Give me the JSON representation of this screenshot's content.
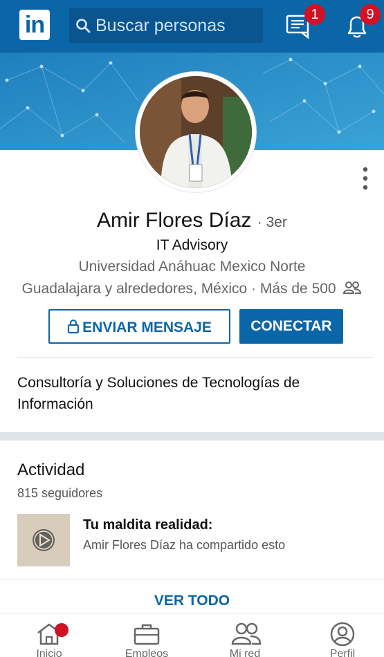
{
  "app": {
    "logo_text": "in"
  },
  "search": {
    "placeholder": "Buscar personas"
  },
  "header": {
    "messages_badge": "1",
    "notifications_badge": "9"
  },
  "profile": {
    "name": "Amir Flores Díaz",
    "degree": "· 3er",
    "headline": "IT Advisory",
    "school": "Universidad Anáhuac Mexico Norte",
    "location_connections": "Guadalajara y alrededores, México · Más de 500"
  },
  "actions": {
    "message_label": "ENVIAR MENSAJE",
    "connect_label": "CONECTAR"
  },
  "summary": {
    "text": "Consultoría y Soluciones de Tecnologías de Información"
  },
  "activity": {
    "title": "Actividad",
    "followers": "815 seguidores",
    "post_title": "Tu maldita realidad:",
    "post_subtitle": "Amir Flores Díaz ha compartido esto",
    "see_all": "VER TODO"
  },
  "bottom_nav": {
    "items": [
      {
        "label": "Inicio",
        "icon": "home-icon"
      },
      {
        "label": "Empleos",
        "icon": "briefcase-icon"
      },
      {
        "label": "Mi red",
        "icon": "network-icon"
      },
      {
        "label": "Perfil",
        "icon": "profile-icon"
      }
    ]
  },
  "colors": {
    "brand": "#0b66a8",
    "badge": "#d11124",
    "cover": "#2c90c7"
  }
}
